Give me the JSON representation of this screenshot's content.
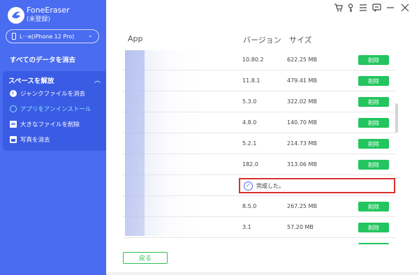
{
  "app": {
    "name": "FoneEraser",
    "status": "(未登録)"
  },
  "device": {
    "label": "L···e(iPhone 12 Pro)"
  },
  "sidebar": {
    "erase_all": "すべてのデータを消去",
    "free_space": {
      "title": "スペースを解放",
      "items": [
        {
          "label": "ジャンクファイルを消去",
          "icon": "broom-clock-icon"
        },
        {
          "label": "アプリをアンインストール",
          "icon": "app-icon",
          "active": true
        },
        {
          "label": "大きなファイルを削除",
          "icon": "file-icon"
        },
        {
          "label": "写真を消去",
          "icon": "photo-icon"
        }
      ]
    }
  },
  "toolbar": [
    "cart-icon",
    "key-icon",
    "menu-icon",
    "feedback-icon",
    "minimize-icon",
    "close-icon"
  ],
  "table": {
    "headers": {
      "app": "App",
      "version": "バージョン",
      "size": "サイズ"
    },
    "rows": [
      {
        "version": "10.80.2",
        "size": "622.25 MB",
        "action": "削除"
      },
      {
        "version": "11.8.1",
        "size": "479.41 MB",
        "action": "削除"
      },
      {
        "version": "5.3.0",
        "size": "322.02 MB",
        "action": "削除"
      },
      {
        "version": "4.8.0",
        "size": "140.70 MB",
        "action": "削除"
      },
      {
        "version": "5.2.1",
        "size": "214.73 MB",
        "action": "削除"
      },
      {
        "version": "182.0",
        "size": "313.06 MB",
        "action": "削除"
      },
      {
        "version": "",
        "size": "",
        "action": "",
        "completed": true
      },
      {
        "version": "8.5.0",
        "size": "267.25 MB",
        "action": "削除"
      },
      {
        "version": "3.1",
        "size": "57.20 MB",
        "action": "削除"
      }
    ],
    "completed_text": "完成した。"
  },
  "footer": {
    "back_label": "戻る"
  },
  "colors": {
    "sidebar": "#4a6cf0",
    "accent_green": "#22c55e",
    "highlight_red": "#d9302c"
  }
}
